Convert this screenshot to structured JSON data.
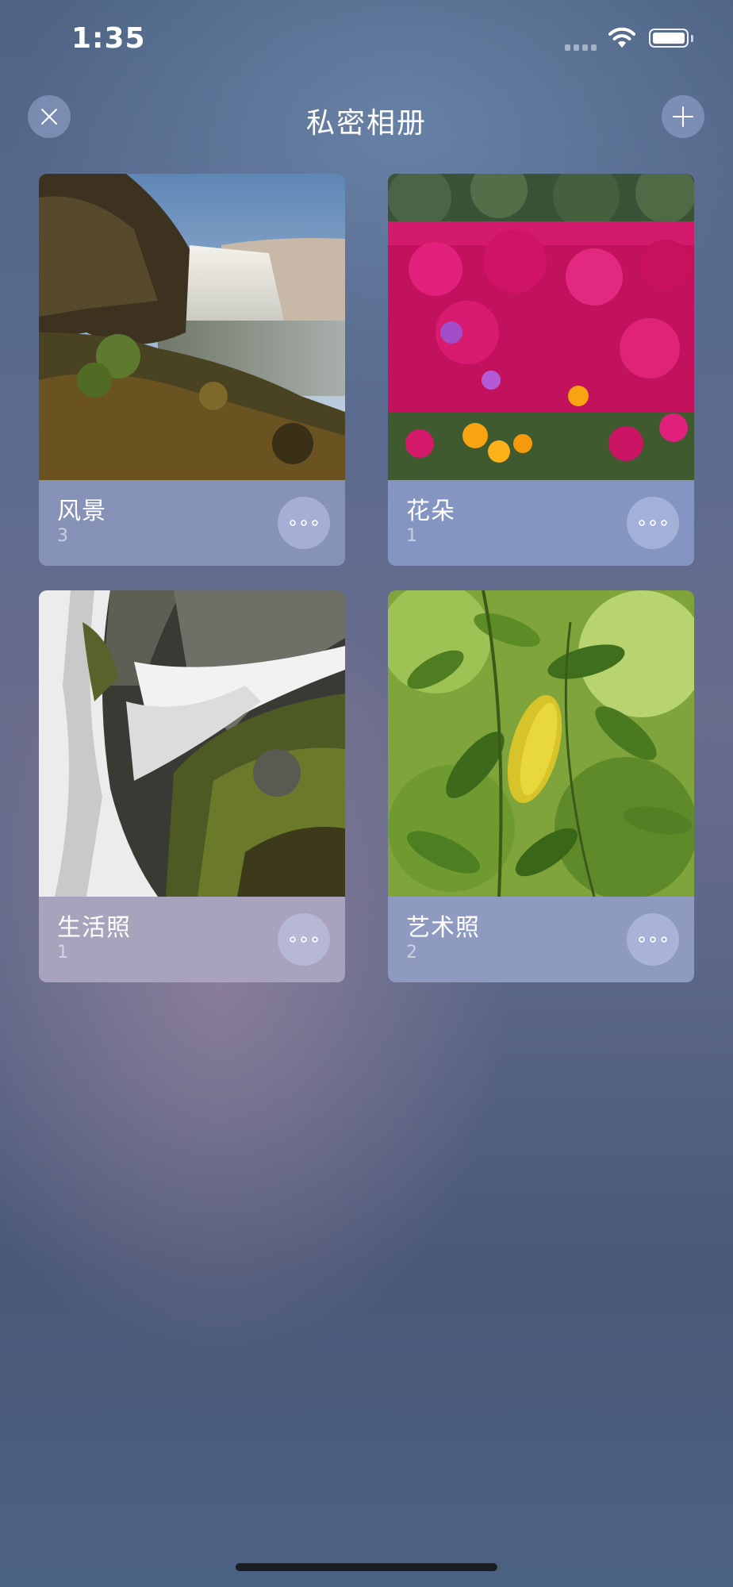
{
  "status_bar": {
    "time": "1:35"
  },
  "header": {
    "title": "私密相册",
    "close_icon": "close-icon",
    "add_icon": "plus-icon"
  },
  "albums": [
    {
      "title": "风景",
      "count": "3",
      "photo": "waterfall-landscape",
      "info_color": "#8792b8"
    },
    {
      "title": "花朵",
      "count": "1",
      "photo": "pink-flowers",
      "info_color": "#8595c2"
    },
    {
      "title": "生活照",
      "count": "1",
      "photo": "waterfall-rocks",
      "info_color": "#a8a2bd"
    },
    {
      "title": "艺术照",
      "count": "2",
      "photo": "green-leaves",
      "info_color": "#8f9ac0"
    }
  ],
  "more_icon": "more-dots-icon",
  "colors": {
    "background_top": "#4f6484",
    "background_bottom": "#4c6282",
    "button_bg": "#9baad2"
  }
}
